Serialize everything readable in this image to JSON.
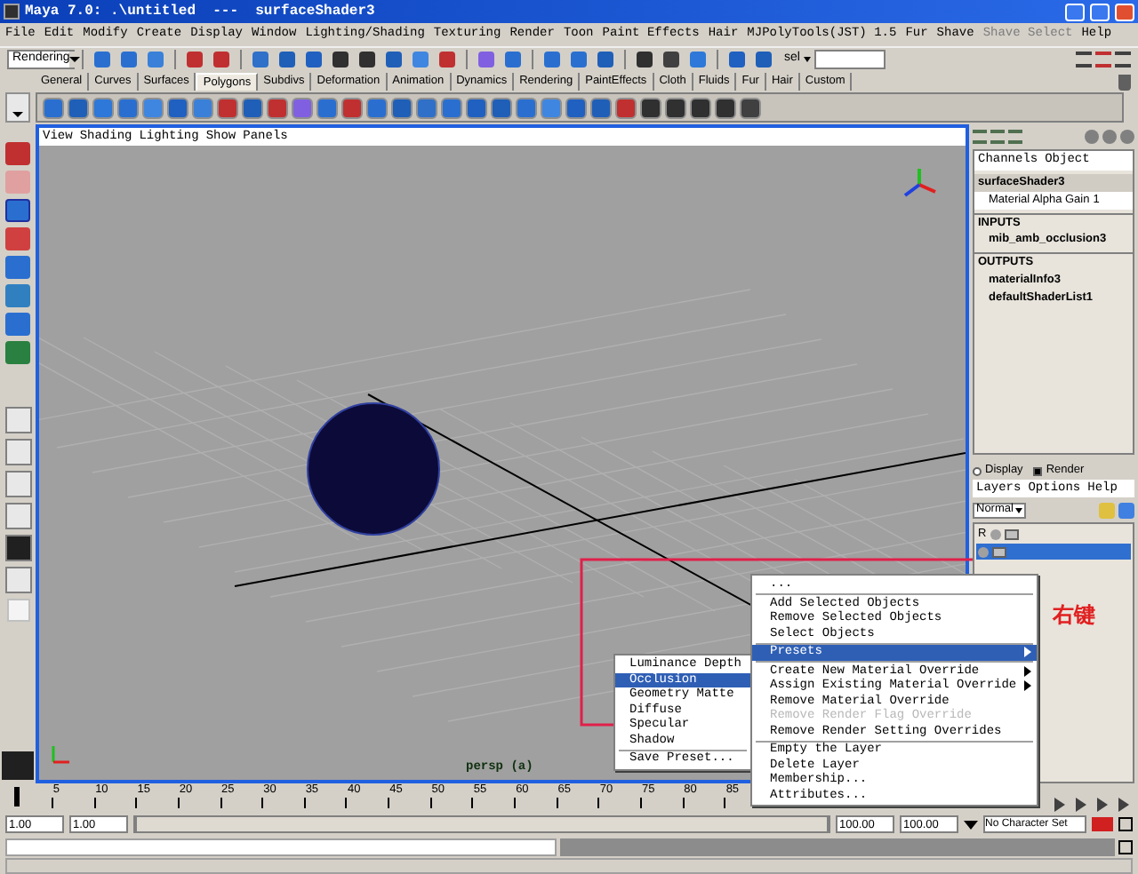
{
  "window": {
    "title": "Maya 7.0: .\\untitled  ---  surfaceShader3"
  },
  "menu_bar": [
    {
      "label": "File",
      "disabled": false
    },
    {
      "label": "Edit",
      "disabled": false
    },
    {
      "label": "Modify",
      "disabled": false
    },
    {
      "label": "Create",
      "disabled": false
    },
    {
      "label": "Display",
      "disabled": false
    },
    {
      "label": "Window",
      "disabled": false
    },
    {
      "label": "Lighting/Shading",
      "disabled": false
    },
    {
      "label": "Texturing",
      "disabled": false
    },
    {
      "label": "Render",
      "disabled": false
    },
    {
      "label": "Toon",
      "disabled": false
    },
    {
      "label": "Paint Effects",
      "disabled": false
    },
    {
      "label": "Hair",
      "disabled": false
    },
    {
      "label": "MJPolyTools(JST) 1.5",
      "disabled": false
    },
    {
      "label": "Fur",
      "disabled": false
    },
    {
      "label": "Shave",
      "disabled": false
    },
    {
      "label": "Shave Select",
      "disabled": true
    },
    {
      "label": "Help",
      "disabled": false
    }
  ],
  "status_line": {
    "menu_set": "Rendering",
    "selection_mode": "sel"
  },
  "shelf_tabs": [
    {
      "label": "General",
      "selected": false
    },
    {
      "label": "Curves",
      "selected": false
    },
    {
      "label": "Surfaces",
      "selected": false
    },
    {
      "label": "Polygons",
      "selected": true
    },
    {
      "label": "Subdivs",
      "selected": false
    },
    {
      "label": "Deformation",
      "selected": false
    },
    {
      "label": "Animation",
      "selected": false
    },
    {
      "label": "Dynamics",
      "selected": false
    },
    {
      "label": "Rendering",
      "selected": false
    },
    {
      "label": "PaintEffects",
      "selected": false
    },
    {
      "label": "Cloth",
      "selected": false
    },
    {
      "label": "Fluids",
      "selected": false
    },
    {
      "label": "Fur",
      "selected": false
    },
    {
      "label": "Hair",
      "selected": false
    },
    {
      "label": "Custom",
      "selected": false
    }
  ],
  "viewport": {
    "menu": [
      "View",
      "Shading",
      "Lighting",
      "Show",
      "Panels"
    ],
    "camera_label": "persp (a)"
  },
  "channel_box": {
    "tabs": [
      "Channels",
      "Object"
    ],
    "node": "surfaceShader3",
    "attributes": [
      {
        "name": "Material Alpha Gain",
        "value": "1"
      }
    ],
    "sections": [
      {
        "title": "INPUTS",
        "items": [
          "mib_amb_occlusion3"
        ]
      },
      {
        "title": "OUTPUTS",
        "items": [
          "materialInfo3",
          "defaultShaderList1"
        ]
      }
    ]
  },
  "layer_editor": {
    "modes": [
      {
        "label": "Display",
        "selected": false
      },
      {
        "label": "Render",
        "selected": true
      }
    ],
    "menu": [
      "Layers",
      "Options",
      "Help"
    ],
    "blend_mode": "Normal",
    "layers": [
      {
        "flag": "R",
        "selected": false
      },
      {
        "selected": true
      }
    ]
  },
  "time_slider": {
    "level": 0,
    "ticks": [
      "5",
      "10",
      "15",
      "20",
      "25",
      "30",
      "35",
      "40",
      "45",
      "50",
      "55",
      "60",
      "65",
      "70",
      "75",
      "80",
      "85"
    ]
  },
  "range_slider": {
    "level": 1,
    "start": "1.00",
    "playback_start": "1.00",
    "playback_end": "100.00",
    "end": "100.00",
    "character_set": "No Character Set"
  },
  "context_menu": {
    "items": [
      {
        "kind": "item",
        "label": "...",
        "disabled": false,
        "selected": false,
        "submenu": false
      },
      {
        "kind": "separator"
      },
      {
        "kind": "item",
        "label": "Add Selected Objects",
        "disabled": false,
        "selected": false,
        "submenu": false
      },
      {
        "kind": "item",
        "label": "Remove Selected Objects",
        "disabled": false,
        "selected": false,
        "submenu": false
      },
      {
        "kind": "item",
        "label": "Select Objects",
        "disabled": false,
        "selected": false,
        "submenu": false
      },
      {
        "kind": "separator"
      },
      {
        "kind": "item",
        "label": "Presets",
        "disabled": false,
        "selected": true,
        "submenu": true
      },
      {
        "kind": "separator"
      },
      {
        "kind": "item",
        "label": "Create New Material Override",
        "disabled": false,
        "selected": false,
        "submenu": true
      },
      {
        "kind": "item",
        "label": "Assign Existing Material Override",
        "disabled": false,
        "selected": false,
        "submenu": true
      },
      {
        "kind": "item",
        "label": "Remove Material Override",
        "disabled": false,
        "selected": false,
        "submenu": false
      },
      {
        "kind": "item",
        "label": "Remove Render Flag Override",
        "disabled": true,
        "selected": false,
        "submenu": false
      },
      {
        "kind": "item",
        "label": "Remove Render Setting Overrides",
        "disabled": false,
        "selected": false,
        "submenu": false
      },
      {
        "kind": "separator"
      },
      {
        "kind": "item",
        "label": "Empty the Layer",
        "disabled": false,
        "selected": false,
        "submenu": false
      },
      {
        "kind": "item",
        "label": "Delete Layer",
        "disabled": false,
        "selected": false,
        "submenu": false
      },
      {
        "kind": "item",
        "label": "Membership...",
        "disabled": false,
        "selected": false,
        "submenu": false
      },
      {
        "kind": "item",
        "label": "Attributes...",
        "disabled": false,
        "selected": false,
        "submenu": false
      }
    ]
  },
  "presets_submenu": {
    "items": [
      {
        "kind": "item",
        "label": "Luminance Depth",
        "selected": false
      },
      {
        "kind": "item",
        "label": "Occlusion",
        "selected": true
      },
      {
        "kind": "item",
        "label": "Geometry Matte",
        "selected": false
      },
      {
        "kind": "item",
        "label": "Diffuse",
        "selected": false
      },
      {
        "kind": "item",
        "label": "Specular",
        "selected": false
      },
      {
        "kind": "item",
        "label": "Shadow",
        "selected": false
      },
      {
        "kind": "separator"
      },
      {
        "kind": "item",
        "label": "Save Preset...",
        "selected": false
      }
    ]
  },
  "annotation": {
    "text": "右键"
  }
}
